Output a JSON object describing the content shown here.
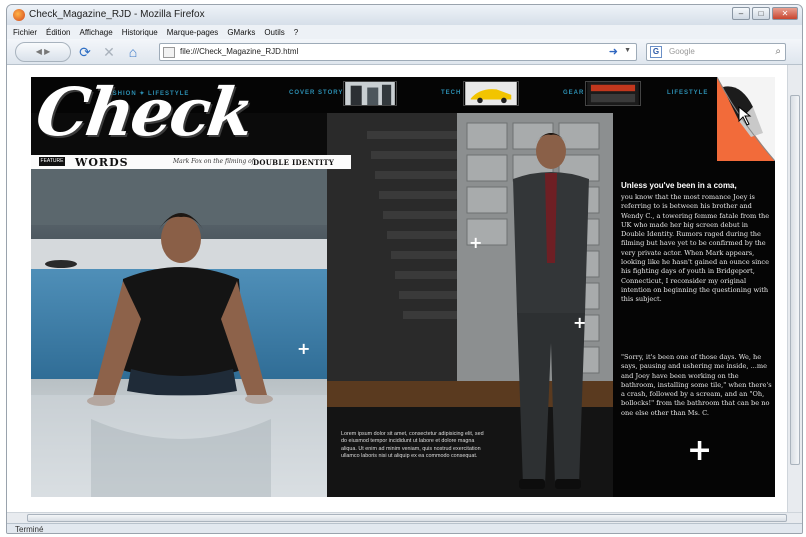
{
  "window": {
    "title": "Check_Magazine_RJD - Mozilla Firefox",
    "controls": [
      "minimize",
      "maximize",
      "close"
    ]
  },
  "menu": [
    "Fichier",
    "Édition",
    "Affichage",
    "Historique",
    "Marque-pages",
    "GMarks",
    "Outils",
    "?"
  ],
  "navbar": {
    "back_label": "",
    "url": "file:///Check_Magazine_RJD.html",
    "search_placeholder": "Google",
    "icons": [
      "back-forward-icon",
      "reload-icon",
      "stop-icon",
      "home-icon",
      "page-icon",
      "go-arrow-icon",
      "google-search-icon",
      "search-icon"
    ]
  },
  "magazine": {
    "logo": "Check",
    "logo_sub": "FASHION ✦ LIFESTYLE",
    "nav": [
      {
        "label": "COVER STORY"
      },
      {
        "label": "TECH"
      },
      {
        "label": "GEAR"
      },
      {
        "label": "LIFESTYLE"
      }
    ],
    "words_bar": {
      "badge": "FEATURE",
      "title": "WORDS",
      "desc": "Mark Fox on the filming of",
      "title_link": "DOUBLE IDENTITY"
    },
    "article": {
      "headline": "Unless you've been in a coma,",
      "body": "you know that the most romance Joey is referring to is between his brother and Wendy C., a towering femme fatale from the UK who made her big screen debut in Double Identity. Rumors raged during the filming but have yet to be confirmed by the very private actor. When Mark appears, looking like he hasn't gained an ounce since his fighting days of youth in Bridgeport, Connecticut, I reconsider my original intention on beginning the questioning with this subject.",
      "quote": "\"Sorry, it's been one of those days. We, he says, pausing and ushering me inside, ...me and Joey have been working on the bathroom, installing some tile,\" when there's a crash, followed by a scream, and an \"Oh, bollocks!\" from the bathroom that can be no one else other than Ms. C."
    },
    "caption": "Lorem ipsum dolor sit amet, consectetur adipisicing elit, sed do eiusmod tempor incididunt ut labore et dolore magna aliqua. Ut enim ad minim veniam, quis nostrud exercitation ullamco laboris nisi ut aliquip ex ea commodo consequat."
  },
  "status": {
    "text": "Terminé"
  }
}
